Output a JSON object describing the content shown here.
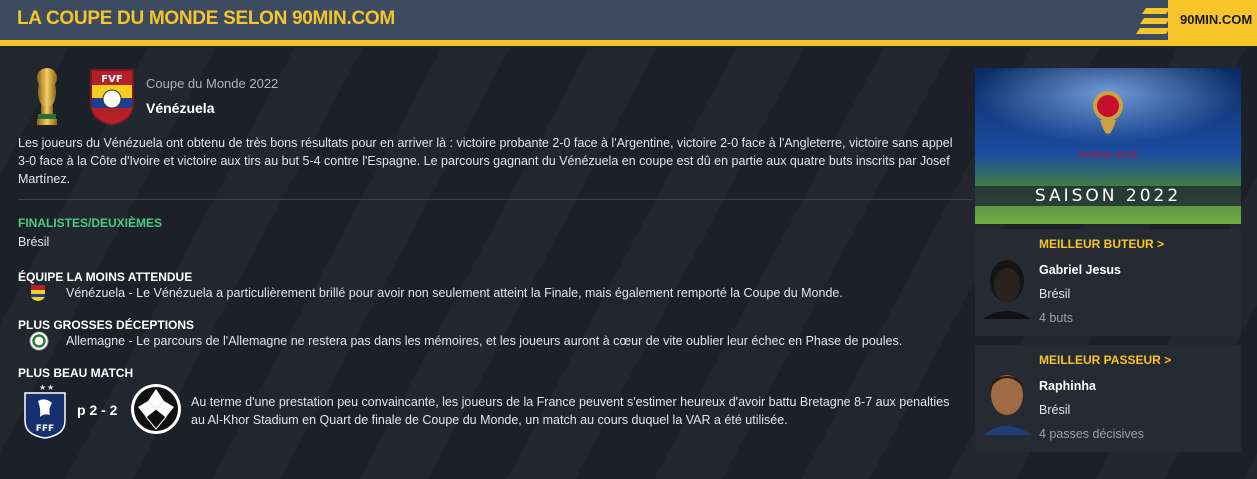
{
  "header": {
    "title": "LA COUPE DU MONDE SELON 90MIN.COM",
    "logo": "90MIN.COM"
  },
  "main": {
    "competition": "Coupe du Monde 2022",
    "team": "Vénézuela",
    "summary": "Les joueurs du Vénézuela ont obtenu de très bons résultats pour en arriver là : victoire probante 2-0 face à l'Argentine, victoire 2-0 face à l'Angleterre, victoire sans appel 3-0 face à la Côte d'Ivoire et victoire aux tirs au but 5-4 contre l'Espagne. Le parcours gagnant du Vénézuela en coupe est dû en partie aux quatre buts inscrits par Josef Martínez.",
    "sections": {
      "finalists": {
        "title": "FINALISTES/DEUXIÈMES",
        "text": "Brésil"
      },
      "underdog": {
        "title": "ÉQUIPE LA MOINS ATTENDUE",
        "text": "Vénézuela - Le Vénézuela a particulièrement brillé pour avoir non seulement atteint la Finale, mais également remporté la Coupe du Monde."
      },
      "disappointment": {
        "title": "PLUS GROSSES DÉCEPTIONS",
        "text": "Allemagne - Le parcours de l'Allemagne ne restera pas dans les mémoires, et les joueurs auront à cœur de vite oublier leur échec en Phase de poules."
      },
      "best_match": {
        "title": "PLUS BEAU MATCH",
        "score": "p 2 - 2",
        "text": "Au terme d'une prestation peu convaincante, les joueurs de la France peuvent s'estimer heureux d'avoir battu Bretagne 8-7 aux penalties au Al-Khor Stadium en Quart de finale de Coupe du Monde, un match au cours duquel la VAR a été utilisée."
      }
    }
  },
  "sidebar": {
    "banner": {
      "logo_text": "RUSSIA 2018",
      "season": "SAISON 2022"
    },
    "top_scorer": {
      "label": "MEILLEUR BUTEUR >",
      "name": "Gabriel Jesus",
      "team": "Brésil",
      "stat": "4 buts"
    },
    "top_assist": {
      "label": "MEILLEUR PASSEUR >",
      "name": "Raphinha",
      "team": "Brésil",
      "stat": "4 passes décisives"
    }
  },
  "colors": {
    "accent": "#f6c52a",
    "header_bg": "#3c4b60",
    "green": "#4ecb7f",
    "page_bg": "#1d222b"
  }
}
